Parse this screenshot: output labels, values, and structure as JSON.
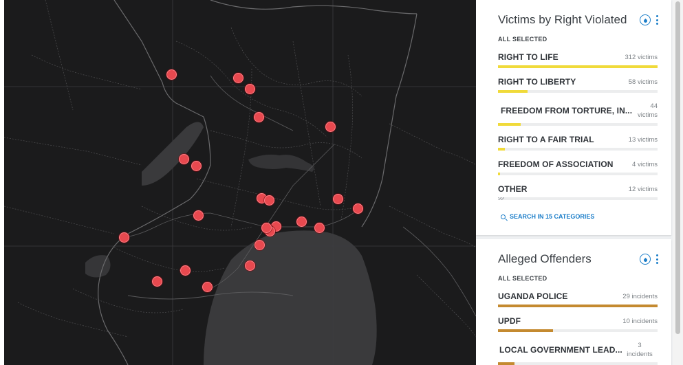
{
  "map": {
    "marker_color": "#e8494f",
    "background_color": "#1b1b1c",
    "marker_count": 24
  },
  "victims_panel": {
    "title": "Victims by Right Violated",
    "all_selected": "ALL SELECTED",
    "bar_color": "#f0da3a",
    "rows": [
      {
        "label": "RIGHT TO LIFE",
        "count": "312 victims",
        "value": 312
      },
      {
        "label": "RIGHT TO LIBERTY",
        "count": "58 victims",
        "value": 58
      },
      {
        "label": "FREEDOM FROM TORTURE, IN...",
        "count_line1": "44",
        "count_line2": "victims",
        "value": 44
      },
      {
        "label": "RIGHT TO A FAIR TRIAL",
        "count": "13 victims",
        "value": 13
      },
      {
        "label": "FREEDOM OF ASSOCIATION",
        "count": "4 victims",
        "value": 4
      },
      {
        "label": "OTHER",
        "count": "12 victims",
        "value": 12
      }
    ],
    "search_link": "SEARCH IN 15 CATEGORIES"
  },
  "offenders_panel": {
    "title": "Alleged Offenders",
    "all_selected": "ALL SELECTED",
    "bar_color": "#c48a30",
    "rows": [
      {
        "label": "UGANDA POLICE",
        "count": "29 incidents",
        "value": 29
      },
      {
        "label": "UPDF",
        "count": "10 incidents",
        "value": 10
      },
      {
        "label": "LOCAL GOVERNMENT LEAD...",
        "count_line1": "3",
        "count_line2": "incidents",
        "value": 3
      }
    ]
  }
}
